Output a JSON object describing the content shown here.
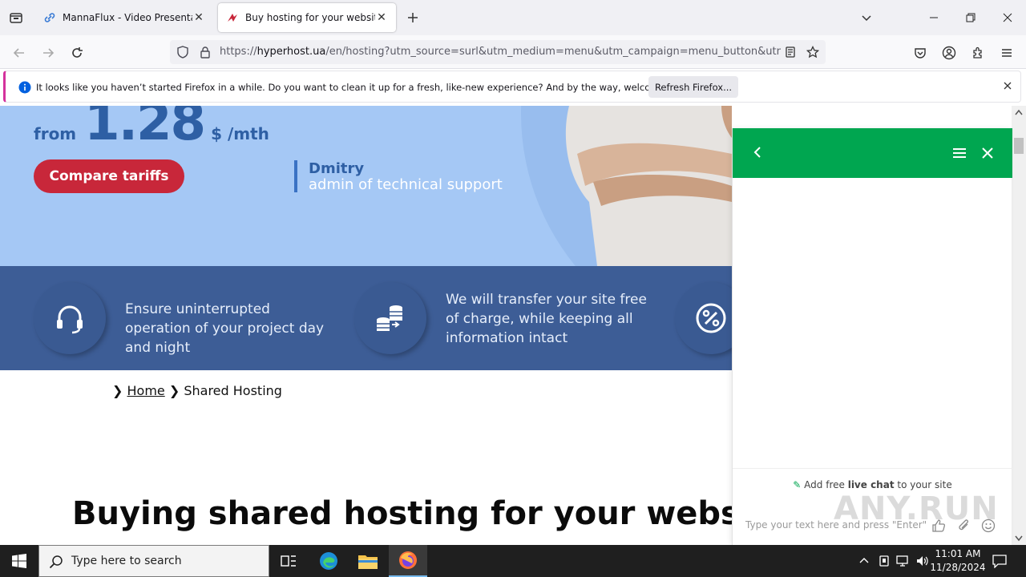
{
  "browser": {
    "tabs": [
      {
        "title": "MannaFlux - Video Presentation"
      },
      {
        "title": "Buy hosting for your website. R"
      }
    ],
    "url_prefix": "https://",
    "url_host": "hyperhost.ua",
    "url_rest": "/en/hosting?utm_source=surl&utm_medium=menu&utm_campaign=menu_button&utm_co"
  },
  "notification": {
    "message": "It looks like you haven’t started Firefox in a while. Do you want to clean it up for a fresh, like-new experience? And by the way, welcome back!",
    "button": "Refresh Firefox..."
  },
  "hero": {
    "from": "from",
    "price": "1.28",
    "unit": "$ /mth",
    "cta": "Compare tariffs",
    "quote_name": "Dmitry",
    "quote_role": "admin of technical support"
  },
  "features": [
    {
      "icon": "headset-icon",
      "text": "Ensure uninterrupted operation of your project day and night"
    },
    {
      "icon": "database-transfer-icon",
      "text": "We will transfer your site free of charge, while keeping all information intact"
    },
    {
      "icon": "percent-icon",
      "text": ""
    }
  ],
  "breadcrumb": {
    "home": "Home",
    "current": "Shared Hosting"
  },
  "headline": "Buying shared hosting for your website is a",
  "chat": {
    "promo_prefix": "Add free ",
    "promo_bold": "live chat",
    "promo_suffix": " to your site",
    "input_placeholder": "Type your text here and press \"Enter\"",
    "accent_color": "#00a650"
  },
  "watermark": "ANY.RUN",
  "taskbar": {
    "search_placeholder": "Type here to search",
    "time": "11:01 AM",
    "date": "11/28/2024"
  }
}
